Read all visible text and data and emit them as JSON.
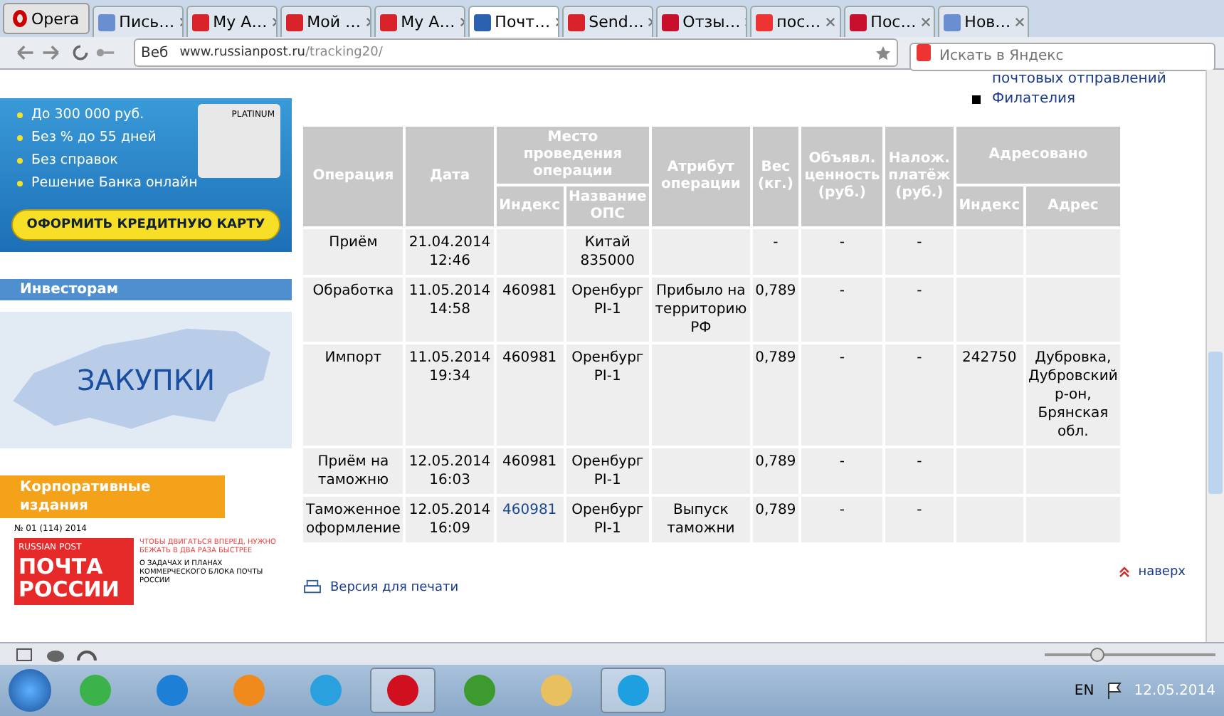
{
  "browser": {
    "menu_label": "Opera",
    "tabs": [
      {
        "label": "Пись…",
        "kind": "mail",
        "selected": false
      },
      {
        "label": "My A…",
        "kind": "cart",
        "selected": false
      },
      {
        "label": "Мой …",
        "kind": "cart",
        "selected": false
      },
      {
        "label": "My A…",
        "kind": "cart",
        "selected": false
      },
      {
        "label": "Почт…",
        "kind": "eagle",
        "selected": true
      },
      {
        "label": "Send…",
        "kind": "cart",
        "selected": false
      },
      {
        "label": "Отзы…",
        "kind": "m",
        "selected": false
      },
      {
        "label": "пос…",
        "kind": "ya",
        "selected": false
      },
      {
        "label": "Пос…",
        "kind": "m",
        "selected": false
      },
      {
        "label": "Нов…",
        "kind": "mail",
        "selected": false
      }
    ],
    "address": {
      "badge": "Веб",
      "host": "www.russianpost.ru",
      "path": "/tracking20/"
    },
    "search": {
      "placeholder": "Искать в Яндекс"
    }
  },
  "sidebar": {
    "credit_ad": {
      "bullets": [
        "До 300 000 руб.",
        "Без % до 55 дней",
        "Без справок",
        "Решение Банка онлайн"
      ],
      "card_label": "PLATINUM",
      "button": "ОФОРМИТЬ КРЕДИТНУЮ КАРТУ"
    },
    "investors": {
      "title": "Инвесторам",
      "banner": "ЗАКУПКИ"
    },
    "corporate": {
      "title": "Корпоративные издания",
      "issue": "№ 01 (114) 2014",
      "brand": "RUSSIAN POST",
      "cover_title": "ПОЧТА РОССИИ",
      "headlines": [
        "ЧТОБЫ ДВИГАТЬСЯ ВПЕРЕД, НУЖНО БЕЖАТЬ В ДВА РАЗА БЫСТРЕЕ",
        "О ЗАДАЧАХ И ПЛАНАХ КОММЕРЧЕСКОГО БЛОКА ПОЧТЫ РОССИИ"
      ]
    }
  },
  "top_links": [
    {
      "label": "почтовых отправлений"
    },
    {
      "label": "Филателия",
      "bullet": true
    }
  ],
  "table": {
    "header_top": [
      "Операция",
      "Дата",
      "Место проведения операции",
      "Атрибут операции",
      "Вес (кг.)",
      "Объявл. ценность (руб.)",
      "Налож. платёж (руб.)",
      "Адресовано"
    ],
    "header_sub": [
      "Индекс",
      "Название ОПС",
      "Индекс",
      "Адрес"
    ],
    "rows": [
      {
        "operation": "Приём",
        "date": "21.04.2014 12:46",
        "ops_name": "Китай 835000",
        "weight": "-",
        "declared_value": "-",
        "cod": "-"
      },
      {
        "operation": "Обработка",
        "date": "11.05.2014 14:58",
        "index": "460981",
        "ops_name": "Оренбург PI-1",
        "attribute": "Прибыло на территорию РФ",
        "weight": "0,789",
        "declared_value": "-",
        "cod": "-",
        "index_link": false
      },
      {
        "operation": "Импорт",
        "date": "11.05.2014 19:34",
        "index": "460981",
        "ops_name": "Оренбург PI-1",
        "weight": "0,789",
        "declared_value": "-",
        "cod": "-",
        "addr_index": "242750",
        "address": "Дубровка, Дубровский р-он, Брянская обл.",
        "index_link": false
      },
      {
        "operation": "Приём на таможню",
        "date": "12.05.2014 16:03",
        "index": "460981",
        "ops_name": "Оренбург PI-1",
        "weight": "0,789",
        "declared_value": "-",
        "cod": "-",
        "index_link": false
      },
      {
        "operation": "Таможенное оформление",
        "date": "12.05.2014 16:09",
        "index": "460981",
        "ops_name": "Оренбург PI-1",
        "attribute": "Выпуск таможни",
        "weight": "0,789",
        "declared_value": "-",
        "cod": "-",
        "index_link": true
      }
    ]
  },
  "print_link": "Версия для печати",
  "top_link": "наверх",
  "taskbar": {
    "apps": [
      {
        "kind": "mail",
        "active": false
      },
      {
        "kind": "ie",
        "active": false
      },
      {
        "kind": "media",
        "active": false
      },
      {
        "kind": "x",
        "active": false
      },
      {
        "kind": "opera",
        "active": true
      },
      {
        "kind": "torrent",
        "active": false
      },
      {
        "kind": "folder",
        "active": false
      },
      {
        "kind": "skype",
        "active": true
      }
    ],
    "language": "EN",
    "date": "12.05.2014"
  },
  "zoom_slider": {
    "level": 0.3
  }
}
